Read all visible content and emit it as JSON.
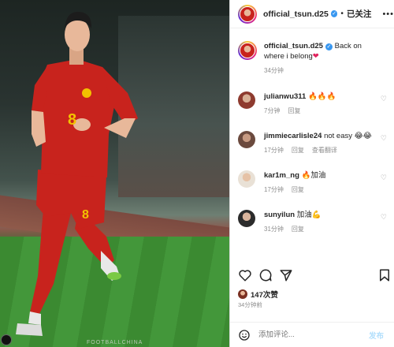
{
  "header": {
    "username": "official_tsun.d25",
    "verified": true,
    "follow_label": "已关注",
    "separator": "•",
    "more_label": "•••"
  },
  "caption": {
    "username": "official_tsun.d25",
    "text": "Back on where i belong",
    "emoji": "❤",
    "time": "34分钟"
  },
  "comments": [
    {
      "username": "julianwu311",
      "text": "🔥🔥🔥",
      "time": "7分钟",
      "reply": "回复",
      "extra": ""
    },
    {
      "username": "jimmiecarlisle24",
      "text": "not easy 😂😂",
      "time": "17分钟",
      "reply": "回复",
      "extra": "查看翻译"
    },
    {
      "username": "kar1m_ng",
      "text": "🔥加油",
      "time": "17分钟",
      "reply": "回复",
      "extra": ""
    },
    {
      "username": "sunyilun",
      "text": "加油💪",
      "time": "31分钟",
      "reply": "回复",
      "extra": ""
    }
  ],
  "likes": {
    "count_label": "147次赞"
  },
  "post_time": "34分钟前",
  "composer": {
    "placeholder": "添加评论...",
    "post_label": "发布"
  },
  "photo": {
    "watermark": "FOOTBALLCHINA"
  },
  "colors": {
    "jersey": "#c8231d",
    "accent_blue": "#3897f0",
    "secondary_text": "#8e8e8e"
  },
  "icons": [
    "heart-icon",
    "comment-icon",
    "share-icon",
    "bookmark-icon",
    "emoji-icon",
    "more-icon"
  ]
}
